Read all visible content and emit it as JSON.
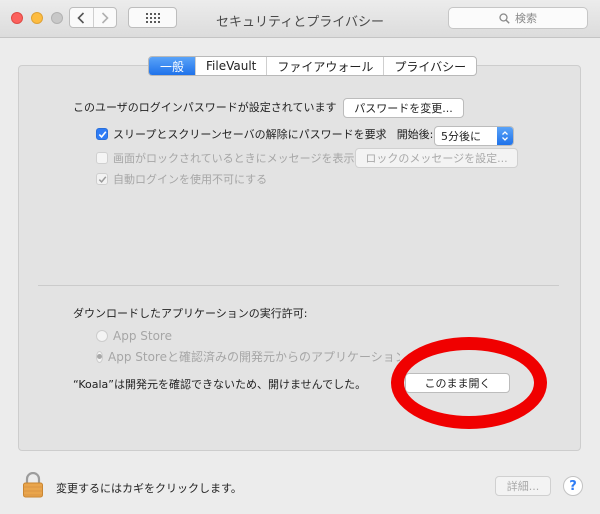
{
  "window": {
    "title": "セキュリティとプライバシー",
    "search_placeholder": "検索"
  },
  "tabs": [
    {
      "label": "一般",
      "active": true
    },
    {
      "label": "FileVault",
      "active": false
    },
    {
      "label": "ファイアウォール",
      "active": false
    },
    {
      "label": "プライバシー",
      "active": false
    }
  ],
  "general": {
    "password_label": "このユーザのログインパスワードが設定されています",
    "change_password_button": "パスワードを変更...",
    "require_password": {
      "label": "スリープとスクリーンセーバの解除にパスワードを要求",
      "checked": true,
      "after_label": "開始後:",
      "after_value": "5分後に"
    },
    "show_message": {
      "label": "画面がロックされているときにメッセージを表示",
      "checked": false,
      "button": "ロックのメッセージを設定..."
    },
    "disable_autologin": {
      "label": "自動ログインを使用不可にする",
      "checked": true
    }
  },
  "downloads": {
    "heading": "ダウンロードしたアプリケーションの実行許可:",
    "options": [
      {
        "label": "App Store",
        "selected": false
      },
      {
        "label": "App Storeと確認済みの開発元からのアプリケーションを許",
        "selected": true
      }
    ],
    "blocked_message": "“Koala”は開発元を確認できないため、開けませんでした。",
    "open_anyway_button": "このまま開く"
  },
  "footer": {
    "lock_label": "変更するにはカギをクリックします。",
    "advanced_button": "詳細...",
    "help_glyph": "?"
  },
  "colors": {
    "accent": "#2e7cf6",
    "annotation": "#f00000"
  }
}
